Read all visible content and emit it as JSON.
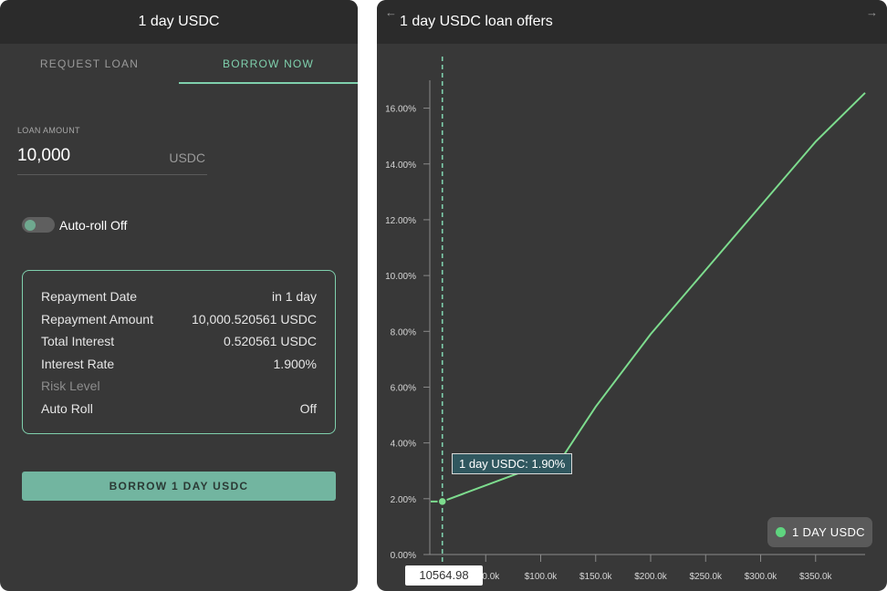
{
  "left": {
    "title": "1 day USDC",
    "tabs": [
      {
        "label": "REQUEST LOAN",
        "active": false
      },
      {
        "label": "BORROW NOW",
        "active": true
      }
    ],
    "loan_amount": {
      "label": "LOAN AMOUNT",
      "value": "10,000",
      "unit": "USDC"
    },
    "auto_roll": {
      "label": "Auto-roll Off",
      "on": false
    },
    "summary": [
      {
        "key": "Repayment Date",
        "value": "in 1 day",
        "muted": false
      },
      {
        "key": "Repayment Amount",
        "value": "10,000.520561 USDC",
        "muted": false
      },
      {
        "key": "Total Interest",
        "value": "0.520561 USDC",
        "muted": false
      },
      {
        "key": "Interest Rate",
        "value": "1.900%",
        "muted": false
      },
      {
        "key": "Risk Level",
        "value": "",
        "muted": true
      },
      {
        "key": "Auto Roll",
        "value": "Off",
        "muted": false
      }
    ],
    "borrow_button": "BORROW 1 DAY USDC"
  },
  "right": {
    "title": "1 day USDC loan offers",
    "back_arrow": "←",
    "forward_arrow": "→",
    "tooltip": "1 day USDC: 1.90%",
    "crosshair_x_label": "10564.98",
    "legend_label": "1 DAY USDC"
  },
  "colors": {
    "accent": "#7fd0ad",
    "line": "#7ddc8e",
    "panel": "#383838",
    "header": "#2b2b2b",
    "button": "#72b5a0"
  },
  "chart_data": {
    "type": "line",
    "title": "1 day USDC loan offers",
    "x_tick_labels": [
      {
        "value": 50000,
        "label": "$50.0k"
      },
      {
        "value": 100000,
        "label": "$100.0k"
      },
      {
        "value": 150000,
        "label": "$150.0k"
      },
      {
        "value": 200000,
        "label": "$200.0k"
      },
      {
        "value": 250000,
        "label": "$250.0k"
      },
      {
        "value": 300000,
        "label": "$300.0k"
      },
      {
        "value": 350000,
        "label": "$350.0k"
      }
    ],
    "y_tick_labels": [
      {
        "value": 0,
        "label": "0.00%"
      },
      {
        "value": 2,
        "label": "2.00%"
      },
      {
        "value": 4,
        "label": "4.00%"
      },
      {
        "value": 6,
        "label": "6.00%"
      },
      {
        "value": 8,
        "label": "8.00%"
      },
      {
        "value": 10,
        "label": "10.00%"
      },
      {
        "value": 12,
        "label": "12.00%"
      },
      {
        "value": 14,
        "label": "14.00%"
      },
      {
        "value": 16,
        "label": "16.00%"
      }
    ],
    "xlim": [
      0,
      395000
    ],
    "ylim": [
      0,
      17
    ],
    "series": [
      {
        "name": "1 DAY USDC",
        "color": "#7ddc8e",
        "points": [
          [
            0,
            1.9
          ],
          [
            10564.98,
            1.9
          ],
          [
            120000,
            3.5
          ],
          [
            150000,
            5.3
          ],
          [
            200000,
            7.9
          ],
          [
            250000,
            10.2
          ],
          [
            300000,
            12.5
          ],
          [
            350000,
            14.8
          ],
          [
            395000,
            16.55
          ]
        ]
      }
    ],
    "highlight": {
      "x": 10564.98,
      "y": 1.9
    },
    "grid": false,
    "legend_position": "bottom-right"
  }
}
